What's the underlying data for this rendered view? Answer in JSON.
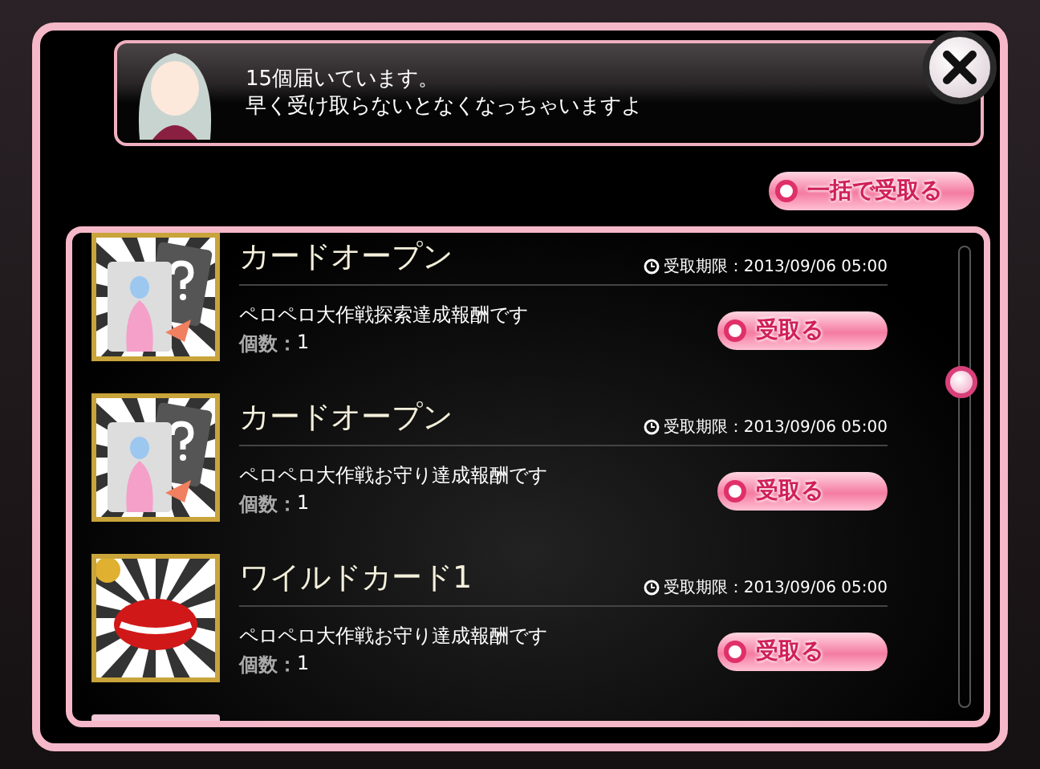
{
  "message": {
    "lines": [
      "15個届いています。",
      "早く受け取らないとなくなっちゃいますよ"
    ]
  },
  "bulk_button": {
    "label": "一括で受取る"
  },
  "items": [
    {
      "kind": "card",
      "title": "カードオープン",
      "deadline": "受取期限：2013/09/06 05:00",
      "description": "ペロペロ大作戦探索達成報酬です",
      "count_label": "個数：",
      "count": "1",
      "button": "受取る"
    },
    {
      "kind": "card",
      "title": "カードオープン",
      "deadline": "受取期限：2013/09/06 05:00",
      "description": "ペロペロ大作戦お守り達成報酬です",
      "count_label": "個数：",
      "count": "1",
      "button": "受取る"
    },
    {
      "kind": "lips",
      "title": "ワイルドカード1",
      "deadline": "受取期限：2013/09/06 05:00",
      "description": "ペロペロ大作戦お守り達成報酬です",
      "count_label": "個数：",
      "count": "1",
      "button": "受取る"
    }
  ]
}
